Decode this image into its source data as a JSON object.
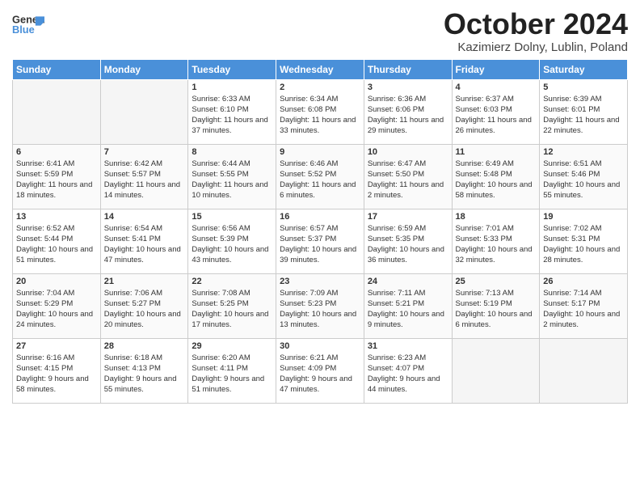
{
  "logo": {
    "line1": "General",
    "line2": "Blue"
  },
  "title": "October 2024",
  "subtitle": "Kazimierz Dolny, Lublin, Poland",
  "days_of_week": [
    "Sunday",
    "Monday",
    "Tuesday",
    "Wednesday",
    "Thursday",
    "Friday",
    "Saturday"
  ],
  "weeks": [
    [
      {
        "day": "",
        "info": ""
      },
      {
        "day": "",
        "info": ""
      },
      {
        "day": "1",
        "info": "Sunrise: 6:33 AM\nSunset: 6:10 PM\nDaylight: 11 hours and 37 minutes."
      },
      {
        "day": "2",
        "info": "Sunrise: 6:34 AM\nSunset: 6:08 PM\nDaylight: 11 hours and 33 minutes."
      },
      {
        "day": "3",
        "info": "Sunrise: 6:36 AM\nSunset: 6:06 PM\nDaylight: 11 hours and 29 minutes."
      },
      {
        "day": "4",
        "info": "Sunrise: 6:37 AM\nSunset: 6:03 PM\nDaylight: 11 hours and 26 minutes."
      },
      {
        "day": "5",
        "info": "Sunrise: 6:39 AM\nSunset: 6:01 PM\nDaylight: 11 hours and 22 minutes."
      }
    ],
    [
      {
        "day": "6",
        "info": "Sunrise: 6:41 AM\nSunset: 5:59 PM\nDaylight: 11 hours and 18 minutes."
      },
      {
        "day": "7",
        "info": "Sunrise: 6:42 AM\nSunset: 5:57 PM\nDaylight: 11 hours and 14 minutes."
      },
      {
        "day": "8",
        "info": "Sunrise: 6:44 AM\nSunset: 5:55 PM\nDaylight: 11 hours and 10 minutes."
      },
      {
        "day": "9",
        "info": "Sunrise: 6:46 AM\nSunset: 5:52 PM\nDaylight: 11 hours and 6 minutes."
      },
      {
        "day": "10",
        "info": "Sunrise: 6:47 AM\nSunset: 5:50 PM\nDaylight: 11 hours and 2 minutes."
      },
      {
        "day": "11",
        "info": "Sunrise: 6:49 AM\nSunset: 5:48 PM\nDaylight: 10 hours and 58 minutes."
      },
      {
        "day": "12",
        "info": "Sunrise: 6:51 AM\nSunset: 5:46 PM\nDaylight: 10 hours and 55 minutes."
      }
    ],
    [
      {
        "day": "13",
        "info": "Sunrise: 6:52 AM\nSunset: 5:44 PM\nDaylight: 10 hours and 51 minutes."
      },
      {
        "day": "14",
        "info": "Sunrise: 6:54 AM\nSunset: 5:41 PM\nDaylight: 10 hours and 47 minutes."
      },
      {
        "day": "15",
        "info": "Sunrise: 6:56 AM\nSunset: 5:39 PM\nDaylight: 10 hours and 43 minutes."
      },
      {
        "day": "16",
        "info": "Sunrise: 6:57 AM\nSunset: 5:37 PM\nDaylight: 10 hours and 39 minutes."
      },
      {
        "day": "17",
        "info": "Sunrise: 6:59 AM\nSunset: 5:35 PM\nDaylight: 10 hours and 36 minutes."
      },
      {
        "day": "18",
        "info": "Sunrise: 7:01 AM\nSunset: 5:33 PM\nDaylight: 10 hours and 32 minutes."
      },
      {
        "day": "19",
        "info": "Sunrise: 7:02 AM\nSunset: 5:31 PM\nDaylight: 10 hours and 28 minutes."
      }
    ],
    [
      {
        "day": "20",
        "info": "Sunrise: 7:04 AM\nSunset: 5:29 PM\nDaylight: 10 hours and 24 minutes."
      },
      {
        "day": "21",
        "info": "Sunrise: 7:06 AM\nSunset: 5:27 PM\nDaylight: 10 hours and 20 minutes."
      },
      {
        "day": "22",
        "info": "Sunrise: 7:08 AM\nSunset: 5:25 PM\nDaylight: 10 hours and 17 minutes."
      },
      {
        "day": "23",
        "info": "Sunrise: 7:09 AM\nSunset: 5:23 PM\nDaylight: 10 hours and 13 minutes."
      },
      {
        "day": "24",
        "info": "Sunrise: 7:11 AM\nSunset: 5:21 PM\nDaylight: 10 hours and 9 minutes."
      },
      {
        "day": "25",
        "info": "Sunrise: 7:13 AM\nSunset: 5:19 PM\nDaylight: 10 hours and 6 minutes."
      },
      {
        "day": "26",
        "info": "Sunrise: 7:14 AM\nSunset: 5:17 PM\nDaylight: 10 hours and 2 minutes."
      }
    ],
    [
      {
        "day": "27",
        "info": "Sunrise: 6:16 AM\nSunset: 4:15 PM\nDaylight: 9 hours and 58 minutes."
      },
      {
        "day": "28",
        "info": "Sunrise: 6:18 AM\nSunset: 4:13 PM\nDaylight: 9 hours and 55 minutes."
      },
      {
        "day": "29",
        "info": "Sunrise: 6:20 AM\nSunset: 4:11 PM\nDaylight: 9 hours and 51 minutes."
      },
      {
        "day": "30",
        "info": "Sunrise: 6:21 AM\nSunset: 4:09 PM\nDaylight: 9 hours and 47 minutes."
      },
      {
        "day": "31",
        "info": "Sunrise: 6:23 AM\nSunset: 4:07 PM\nDaylight: 9 hours and 44 minutes."
      },
      {
        "day": "",
        "info": ""
      },
      {
        "day": "",
        "info": ""
      }
    ]
  ]
}
